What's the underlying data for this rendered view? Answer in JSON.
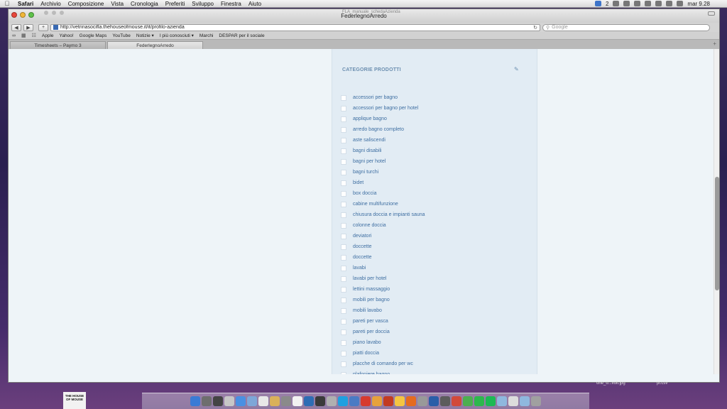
{
  "menubar": {
    "app": "Safari",
    "items": [
      "Archivio",
      "Composizione",
      "Vista",
      "Cronologia",
      "Preferiti",
      "Sviluppo",
      "Finestra",
      "Aiuto"
    ],
    "clock": "mar 9.28",
    "badge_count": "2"
  },
  "window": {
    "title": "FederlegnoArredo",
    "subtitle": "FLA_manuale_schedaAzienda"
  },
  "toolbar": {
    "url": "http://vetrinasocifla.thehouseofmouse.it/it/profilo-azienda",
    "search_placeholder": "Google"
  },
  "bookmarks": [
    "Apple",
    "Yahoo!",
    "Google Maps",
    "YouTube",
    "Notizie ▾",
    "I più conosciuti ▾",
    "Marchi",
    "DESPAR per il sociale"
  ],
  "tabs": [
    "Timesheets – Paymo 3",
    "FederlegnoArredo"
  ],
  "panel": {
    "title": "CATEGORIE PRODOTTI",
    "categories": [
      "accessori per bagno",
      "accessori per bagno per hotel",
      "applique bagno",
      "arredo bagno completo",
      "aste saliscendi",
      "bagni disabili",
      "bagni per hotel",
      "bagni turchi",
      "bidet",
      "box doccia",
      "cabine multifunzione",
      "chiusura doccia e impianti sauna",
      "colonne doccia",
      "deviatori",
      "doccette",
      "doccette",
      "lavabi",
      "lavabi per hotel",
      "lettini massaggio",
      "mobili per bagno",
      "mobili lavabo",
      "pareti per vasca",
      "pareti per doccia",
      "piano lavabo",
      "piatti doccia",
      "placche di comando per wc",
      "plafoniere bagno"
    ]
  },
  "desktop": {
    "file1": "one_o...volt.jpg",
    "file2": "pi.csv",
    "thumb_text": "THE HOUSE OF MOUSE"
  },
  "colors": {
    "panel_bg": "#e2ecf4",
    "link": "#3f6fa2",
    "heading": "#6c8fb0"
  }
}
